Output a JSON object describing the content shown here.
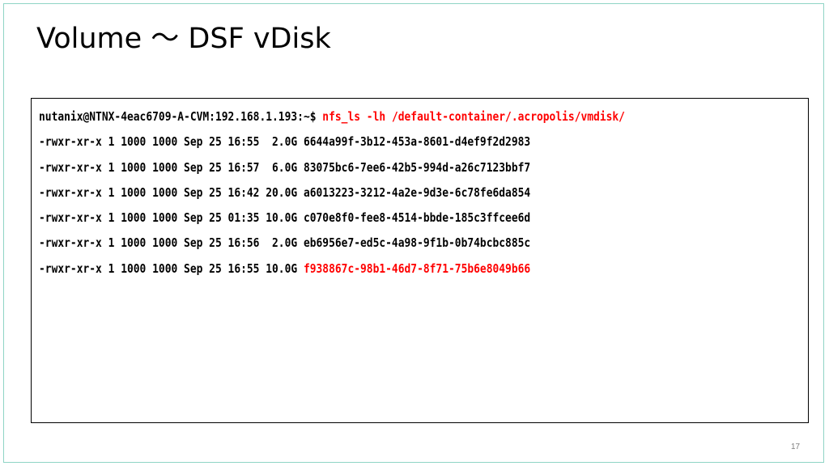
{
  "slide": {
    "title": "Volume ～ DSF vDisk",
    "page_number": "17"
  },
  "terminal": {
    "prompt": "nutanix@NTNX-4eac6709-A-CVM:192.168.1.193:~$ ",
    "command": "nfs_ls -lh /default-container/.acropolis/vmdisk/",
    "rows": [
      {
        "info": "-rwxr-xr-x 1 1000 1000 Sep 25 16:55  2.0G ",
        "name": "6644a99f-3b12-453a-8601-d4ef9f2d2983"
      },
      {
        "info": "-rwxr-xr-x 1 1000 1000 Sep 25 16:57  6.0G ",
        "name": "83075bc6-7ee6-42b5-994d-a26c7123bbf7"
      },
      {
        "info": "-rwxr-xr-x 1 1000 1000 Sep 25 16:42 20.0G ",
        "name": "a6013223-3212-4a2e-9d3e-6c78fe6da854"
      },
      {
        "info": "-rwxr-xr-x 1 1000 1000 Sep 25 01:35 10.0G ",
        "name": "c070e8f0-fee8-4514-bbde-185c3ffcee6d"
      },
      {
        "info": "-rwxr-xr-x 1 1000 1000 Sep 25 16:56  2.0G ",
        "name": "eb6956e7-ed5c-4a98-9f1b-0b74bcbc885c"
      },
      {
        "info": "-rwxr-xr-x 1 1000 1000 Sep 25 16:55 10.0G ",
        "name": "f938867c-98b1-46d7-8f71-75b6e8049b66",
        "highlight": true
      }
    ],
    "colors": {
      "highlight": "#ff0000",
      "text": "#000000",
      "slide_border": "#8fd4c5"
    }
  }
}
